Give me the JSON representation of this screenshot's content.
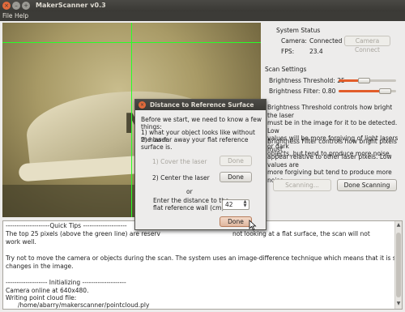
{
  "window": {
    "title": "MakerScanner v0.3"
  },
  "menu": {
    "file": "File",
    "help": "Help"
  },
  "status": {
    "section_title": "System Status",
    "camera_label": "Camera:",
    "camera_value": "Connected",
    "connect_button": "Camera Connect",
    "fps_label": "FPS:",
    "fps_value": "23.4"
  },
  "settings": {
    "section_title": "Scan Settings",
    "threshold_label": "Brightness Threshold: 25",
    "threshold_level": 0.25,
    "filter_label": "Brightness Filter: 0.80",
    "filter_level": 0.8,
    "threshold_desc": [
      "Brightness Threshold controls how bright the laser",
      "must be in the image for it to be detected.  Low",
      "values will be more forgiving of light lasers or dark",
      "objects, but tend to produce more noise."
    ],
    "filter_desc": [
      "Brightness Filter controls how bright pixels must",
      "appear relative to other laser pixels.  Low values are",
      "more forgiving but tend to produce more noise."
    ],
    "scanning_button": "Scanning...",
    "done_scanning_button": "Done Scanning"
  },
  "dialog": {
    "title": "Distance to Reference Surface",
    "intro": "Before we start, we need to know a few things:",
    "point1": "1) what your object looks like without the laser.",
    "point2": "2) how far away your flat reference surface is.",
    "step1_label": "1) Cover the laser",
    "step1_button": "Done",
    "step2_label": "2) Center the laser",
    "step2_button": "Done",
    "or_label": "or",
    "distance_label_1": "Enter the distance to the",
    "distance_label_2": "flat reference wall (cm):",
    "distance_value": "42",
    "done_button": "Done"
  },
  "log": {
    "lines": [
      "--------------------Quick Tips --------------------",
      "The top 25 pixels (above the green line) are reserv",
      "not looking at a flat surface, the scan will not",
      "work well.",
      "",
      "Try not to move the camera or objects during the scan.  The system uses an image-difference technique which means that it is sensitive to any",
      "changes in the image.",
      "",
      "------------------- Initializing --------------------",
      "Camera online at 640x480.",
      "Writing point cloud file:",
      "/home/abarry/makerscanner/pointcloud.ply"
    ]
  }
}
